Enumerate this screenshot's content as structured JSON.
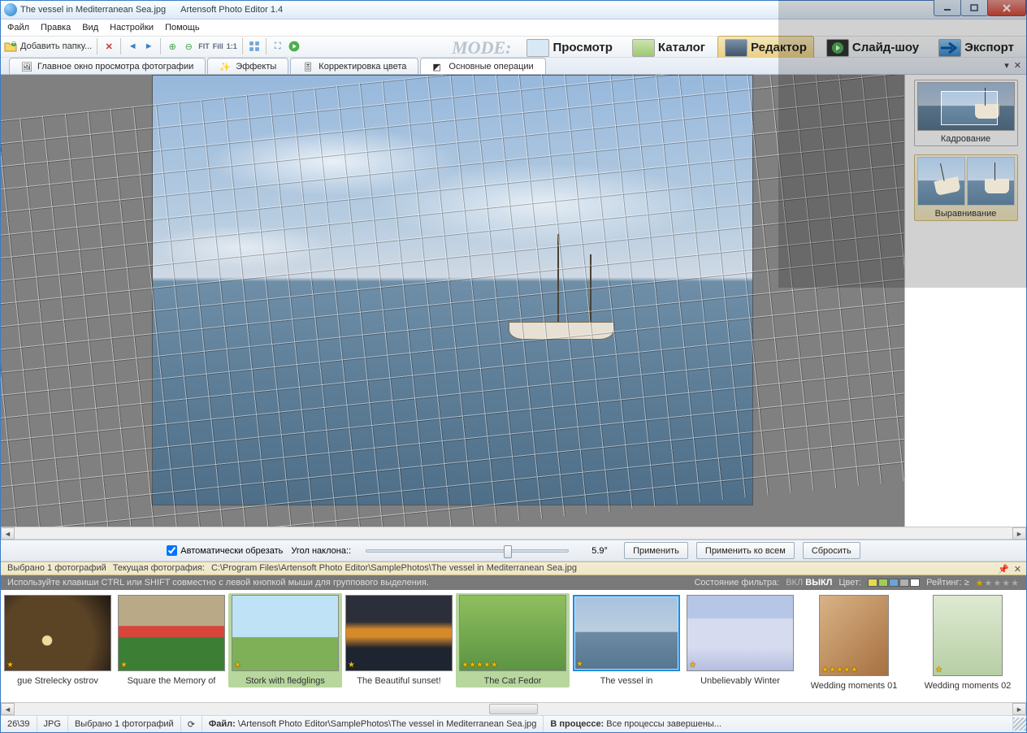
{
  "title": {
    "file": "The vessel in Mediterranean Sea.jpg",
    "app": "Artensoft Photo Editor 1.4"
  },
  "menu": {
    "file": "Файл",
    "edit": "Правка",
    "view": "Вид",
    "settings": "Настройки",
    "help": "Помощь"
  },
  "toolbar": {
    "add_folder": "Добавить папку...",
    "fit": "FIT",
    "fill": "Fill",
    "one": "1:1",
    "mode_label": "MODE:",
    "modes": {
      "view": "Просмотр",
      "catalog": "Каталог",
      "editor": "Редактор",
      "slideshow": "Слайд-шоу",
      "export": "Экспорт"
    }
  },
  "tabs": {
    "main": "Главное окно просмотра фотографии",
    "effects": "Эффекты",
    "color": "Корректировка цвета",
    "basic": "Основные операции"
  },
  "side": {
    "crop": "Кадрование",
    "straighten": "Выравнивание"
  },
  "controls": {
    "auto_crop": "Автоматически обрезать",
    "angle_label": "Угол наклона::",
    "angle_value": "5.9°",
    "apply": "Применить",
    "apply_all": "Применить ко всем",
    "reset": "Сбросить"
  },
  "catalog": {
    "selected_label": "Выбрано 1  фотографий",
    "current_label": "Текущая фотография:",
    "current_path": "C:\\Program Files\\Artensoft Photo Editor\\SamplePhotos\\The vessel in Mediterranean Sea.jpg",
    "hint": "Используйте клавиши CTRL или SHIFT совместно с левой кнопкой мыши для группового выделения.",
    "filter_status": "Состояние фильтра:",
    "on": "ВКЛ",
    "off": "ВЫКЛ",
    "color_label": "Цвет:",
    "rating_label": "Рейтинг: ≥"
  },
  "thumbs": [
    {
      "cap": "gue Strelecky ostrov",
      "cls": "pg",
      "stars": 1
    },
    {
      "cap": "Square the Memory of",
      "cls": "sq",
      "stars": 1
    },
    {
      "cap": "Stork with fledglings",
      "cls": "st",
      "stars": 1,
      "sel": "green"
    },
    {
      "cap": "The Beautiful sunset!",
      "cls": "su",
      "stars": 1
    },
    {
      "cap": "The Cat Fedor",
      "cls": "ca",
      "stars": 5,
      "sel": "green"
    },
    {
      "cap": "The vessel in",
      "cls": "ve",
      "stars": 1,
      "sel": "blue"
    },
    {
      "cap": "Unbelievably Winter",
      "cls": "wi",
      "stars": 1
    },
    {
      "cap": "Wedding moments 01",
      "cls": "wm1",
      "stars": 5,
      "portrait": true
    },
    {
      "cap": "Wedding moments 02",
      "cls": "wm2",
      "stars": 1,
      "portrait": true
    }
  ],
  "status": {
    "counter": "26\\39",
    "format": "JPG",
    "selected": "Выбрано 1 фотографий",
    "file_label": "Файл:",
    "file_path": "\\Artensoft Photo Editor\\SamplePhotos\\The vessel in Mediterranean Sea.jpg",
    "proc_label": "В процессе:",
    "proc_value": "Все процессы завершены..."
  },
  "colors": {
    "swatches": [
      "#e4da4e",
      "#9fcf57",
      "#6aa3d8",
      "#b0b0b0",
      "#ffffff"
    ]
  }
}
